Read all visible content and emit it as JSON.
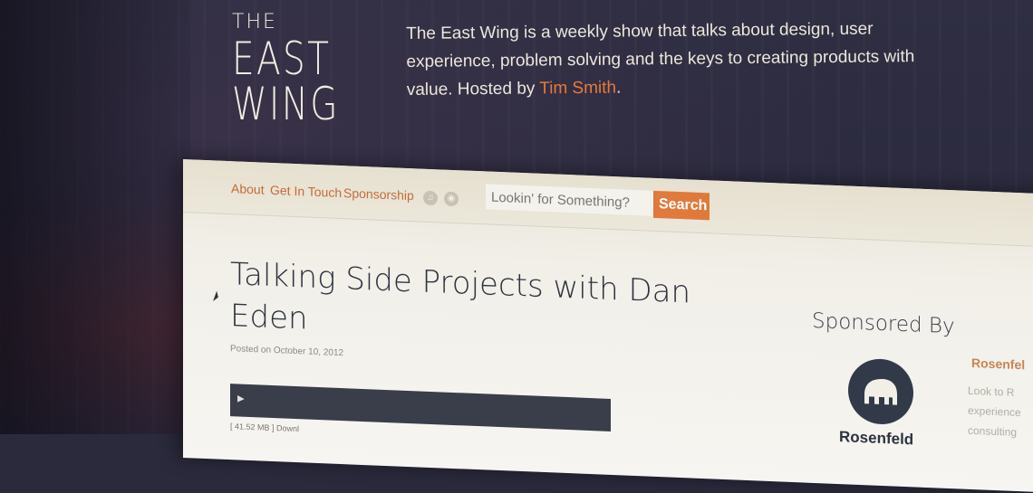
{
  "header": {
    "logo_line1": "THE",
    "logo_line2": "EAST",
    "logo_line3": "WING",
    "tagline_text": "The East Wing is a weekly show that talks about design, user experience, problem solving and the keys to creating products with value. Hosted by ",
    "host_name": "Tim Smith",
    "tagline_end": "."
  },
  "nav": {
    "about": "About",
    "get_in_touch": "Get In Touch",
    "sponsorship": "Sponsorship",
    "icon1": "itunes-icon",
    "icon2": "rss-icon",
    "search_placeholder": "Lookin' for Something?",
    "search_button": "Search"
  },
  "post": {
    "title": "Talking Side Projects with Dan Eden",
    "posted_prefix": "Posted on ",
    "date": "October 10, 2012",
    "file_size": "[ 41.52 MB ]",
    "download": "Downl"
  },
  "sidebar": {
    "sponsored_by": "Sponsored By",
    "sponsor_logo_text": "Rosenfeld",
    "sponsor_title": "Rosenfel",
    "sponsor_desc": "Look to R experience consulting"
  },
  "colors": {
    "accent": "#e07a3c",
    "background": "#2b2a3d",
    "page": "#f1efe8"
  }
}
